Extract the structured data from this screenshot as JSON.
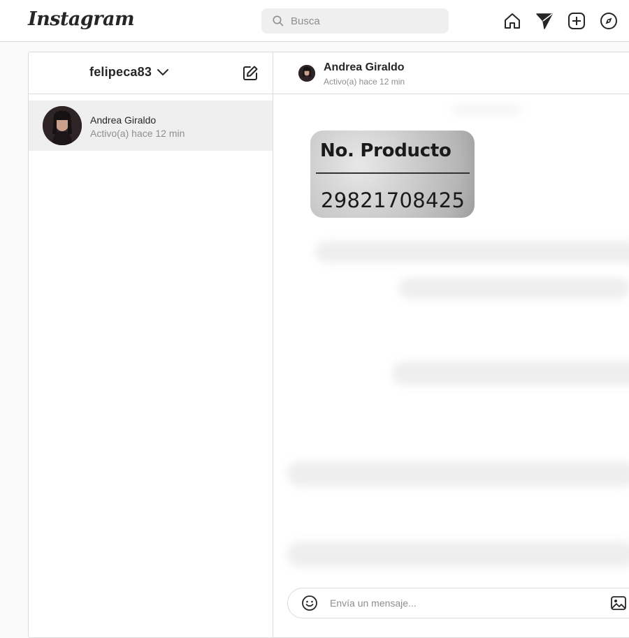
{
  "app": {
    "logo_text": "Instagram"
  },
  "search": {
    "placeholder": "Busca"
  },
  "nav_icons": [
    "home-icon",
    "direct-send-icon",
    "new-post-icon",
    "explore-icon"
  ],
  "inbox": {
    "account_name": "felipeca83",
    "threads": [
      {
        "name": "Andrea Giraldo",
        "status": "Activo(a) hace 12 min"
      }
    ]
  },
  "conversation": {
    "header_name": "Andrea Giraldo",
    "header_status": "Activo(a) hace 12 min",
    "sticker": {
      "title": "No. Producto",
      "number": "29821708425"
    },
    "composer": {
      "placeholder": "Envía un mensaje..."
    }
  },
  "colors": {
    "border": "#dbdbdb",
    "muted_text": "#8e8e8e",
    "selected_thread_bg": "#efefef"
  }
}
